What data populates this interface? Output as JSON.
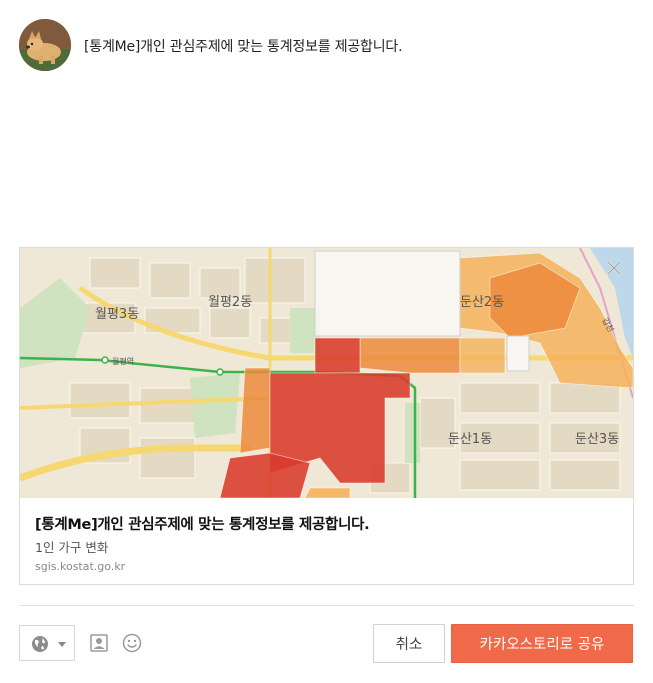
{
  "post": {
    "message": "[통계Me]개인 관심주제에 맞는 통계정보를 제공합니다."
  },
  "card": {
    "title": "[통계Me]개인 관심주제에 맞는 통계정보를 제공합니다.",
    "description": "1인 가구 변화",
    "domain": "sgis.kostat.go.kr",
    "map_labels": {
      "wolpyeong3": "월평3동",
      "wolpyeong2": "월평2동",
      "dunsan1": "둔산1동",
      "dunsan2": "둔산2동",
      "dunsan3": "둔산3동",
      "wolpyeong_station": "월평역",
      "gapcheon": "갑천"
    },
    "colors": {
      "choropleth_dark": "#d93a2b",
      "choropleth_mid": "#ec8a3c",
      "choropleth_light": "#f4b25a",
      "highlight_white": "#f7f6f2"
    }
  },
  "toolbar": {
    "cancel_label": "취소",
    "share_label": "카카오스토리로 공유",
    "icons": [
      "globe-icon",
      "caret-down-icon",
      "person-tag-icon",
      "emoticon-icon"
    ]
  },
  "colors": {
    "share_button": "#f06a4a",
    "divider": "#e3e3e3"
  }
}
